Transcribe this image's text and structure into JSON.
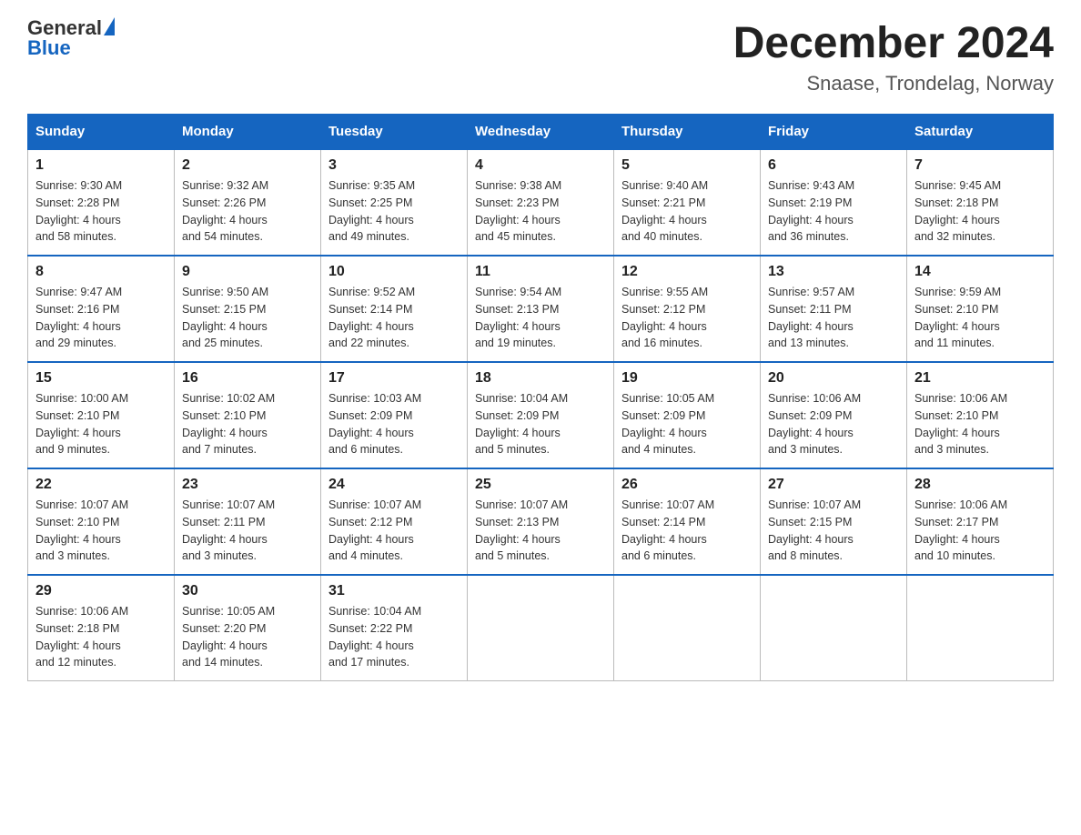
{
  "logo": {
    "text_general": "General",
    "text_blue": "Blue"
  },
  "title": "December 2024",
  "subtitle": "Snaase, Trondelag, Norway",
  "days_of_week": [
    "Sunday",
    "Monday",
    "Tuesday",
    "Wednesday",
    "Thursday",
    "Friday",
    "Saturday"
  ],
  "weeks": [
    [
      {
        "day": 1,
        "sunrise": "9:30 AM",
        "sunset": "2:28 PM",
        "daylight": "4 hours and 58 minutes."
      },
      {
        "day": 2,
        "sunrise": "9:32 AM",
        "sunset": "2:26 PM",
        "daylight": "4 hours and 54 minutes."
      },
      {
        "day": 3,
        "sunrise": "9:35 AM",
        "sunset": "2:25 PM",
        "daylight": "4 hours and 49 minutes."
      },
      {
        "day": 4,
        "sunrise": "9:38 AM",
        "sunset": "2:23 PM",
        "daylight": "4 hours and 45 minutes."
      },
      {
        "day": 5,
        "sunrise": "9:40 AM",
        "sunset": "2:21 PM",
        "daylight": "4 hours and 40 minutes."
      },
      {
        "day": 6,
        "sunrise": "9:43 AM",
        "sunset": "2:19 PM",
        "daylight": "4 hours and 36 minutes."
      },
      {
        "day": 7,
        "sunrise": "9:45 AM",
        "sunset": "2:18 PM",
        "daylight": "4 hours and 32 minutes."
      }
    ],
    [
      {
        "day": 8,
        "sunrise": "9:47 AM",
        "sunset": "2:16 PM",
        "daylight": "4 hours and 29 minutes."
      },
      {
        "day": 9,
        "sunrise": "9:50 AM",
        "sunset": "2:15 PM",
        "daylight": "4 hours and 25 minutes."
      },
      {
        "day": 10,
        "sunrise": "9:52 AM",
        "sunset": "2:14 PM",
        "daylight": "4 hours and 22 minutes."
      },
      {
        "day": 11,
        "sunrise": "9:54 AM",
        "sunset": "2:13 PM",
        "daylight": "4 hours and 19 minutes."
      },
      {
        "day": 12,
        "sunrise": "9:55 AM",
        "sunset": "2:12 PM",
        "daylight": "4 hours and 16 minutes."
      },
      {
        "day": 13,
        "sunrise": "9:57 AM",
        "sunset": "2:11 PM",
        "daylight": "4 hours and 13 minutes."
      },
      {
        "day": 14,
        "sunrise": "9:59 AM",
        "sunset": "2:10 PM",
        "daylight": "4 hours and 11 minutes."
      }
    ],
    [
      {
        "day": 15,
        "sunrise": "10:00 AM",
        "sunset": "2:10 PM",
        "daylight": "4 hours and 9 minutes."
      },
      {
        "day": 16,
        "sunrise": "10:02 AM",
        "sunset": "2:10 PM",
        "daylight": "4 hours and 7 minutes."
      },
      {
        "day": 17,
        "sunrise": "10:03 AM",
        "sunset": "2:09 PM",
        "daylight": "4 hours and 6 minutes."
      },
      {
        "day": 18,
        "sunrise": "10:04 AM",
        "sunset": "2:09 PM",
        "daylight": "4 hours and 5 minutes."
      },
      {
        "day": 19,
        "sunrise": "10:05 AM",
        "sunset": "2:09 PM",
        "daylight": "4 hours and 4 minutes."
      },
      {
        "day": 20,
        "sunrise": "10:06 AM",
        "sunset": "2:09 PM",
        "daylight": "4 hours and 3 minutes."
      },
      {
        "day": 21,
        "sunrise": "10:06 AM",
        "sunset": "2:10 PM",
        "daylight": "4 hours and 3 minutes."
      }
    ],
    [
      {
        "day": 22,
        "sunrise": "10:07 AM",
        "sunset": "2:10 PM",
        "daylight": "4 hours and 3 minutes."
      },
      {
        "day": 23,
        "sunrise": "10:07 AM",
        "sunset": "2:11 PM",
        "daylight": "4 hours and 3 minutes."
      },
      {
        "day": 24,
        "sunrise": "10:07 AM",
        "sunset": "2:12 PM",
        "daylight": "4 hours and 4 minutes."
      },
      {
        "day": 25,
        "sunrise": "10:07 AM",
        "sunset": "2:13 PM",
        "daylight": "4 hours and 5 minutes."
      },
      {
        "day": 26,
        "sunrise": "10:07 AM",
        "sunset": "2:14 PM",
        "daylight": "4 hours and 6 minutes."
      },
      {
        "day": 27,
        "sunrise": "10:07 AM",
        "sunset": "2:15 PM",
        "daylight": "4 hours and 8 minutes."
      },
      {
        "day": 28,
        "sunrise": "10:06 AM",
        "sunset": "2:17 PM",
        "daylight": "4 hours and 10 minutes."
      }
    ],
    [
      {
        "day": 29,
        "sunrise": "10:06 AM",
        "sunset": "2:18 PM",
        "daylight": "4 hours and 12 minutes."
      },
      {
        "day": 30,
        "sunrise": "10:05 AM",
        "sunset": "2:20 PM",
        "daylight": "4 hours and 14 minutes."
      },
      {
        "day": 31,
        "sunrise": "10:04 AM",
        "sunset": "2:22 PM",
        "daylight": "4 hours and 17 minutes."
      },
      null,
      null,
      null,
      null
    ]
  ]
}
